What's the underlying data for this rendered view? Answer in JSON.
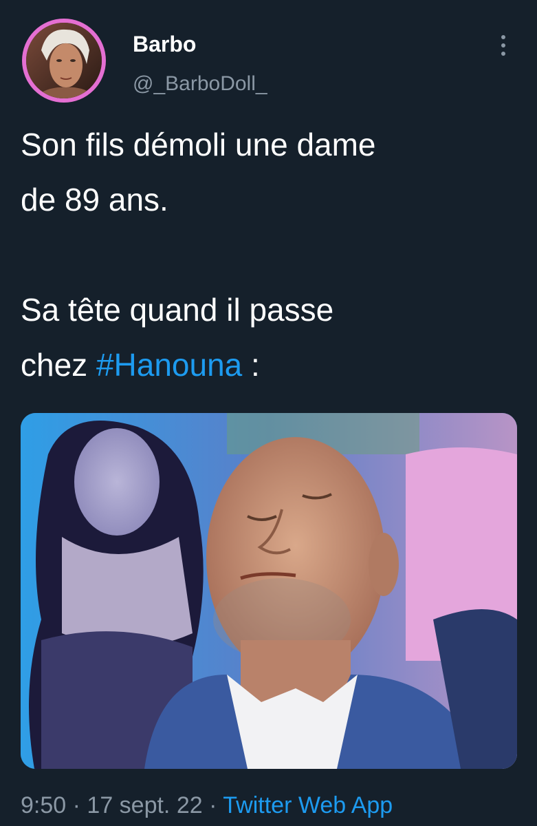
{
  "author": {
    "display_name": "Barbo",
    "handle": "@_BarboDoll_",
    "avatar_ring_color": "#e46fd2"
  },
  "more_icon": "vertical-ellipsis-icon",
  "tweet": {
    "line1": "Son fils démoli une dame",
    "line2": "de 89 ans.",
    "line3": "Sa tête quand il passe",
    "line4_prefix": "chez ",
    "hashtag": "#Hanouna",
    "line4_suffix": " :"
  },
  "meta": {
    "time": "9:50",
    "separator1": " · ",
    "date": "17 sept. 22",
    "separator2": " · ",
    "source": "Twitter Web App"
  },
  "colors": {
    "background": "#15202b",
    "link": "#1d9bf0",
    "secondary_text": "#8b98a5"
  }
}
